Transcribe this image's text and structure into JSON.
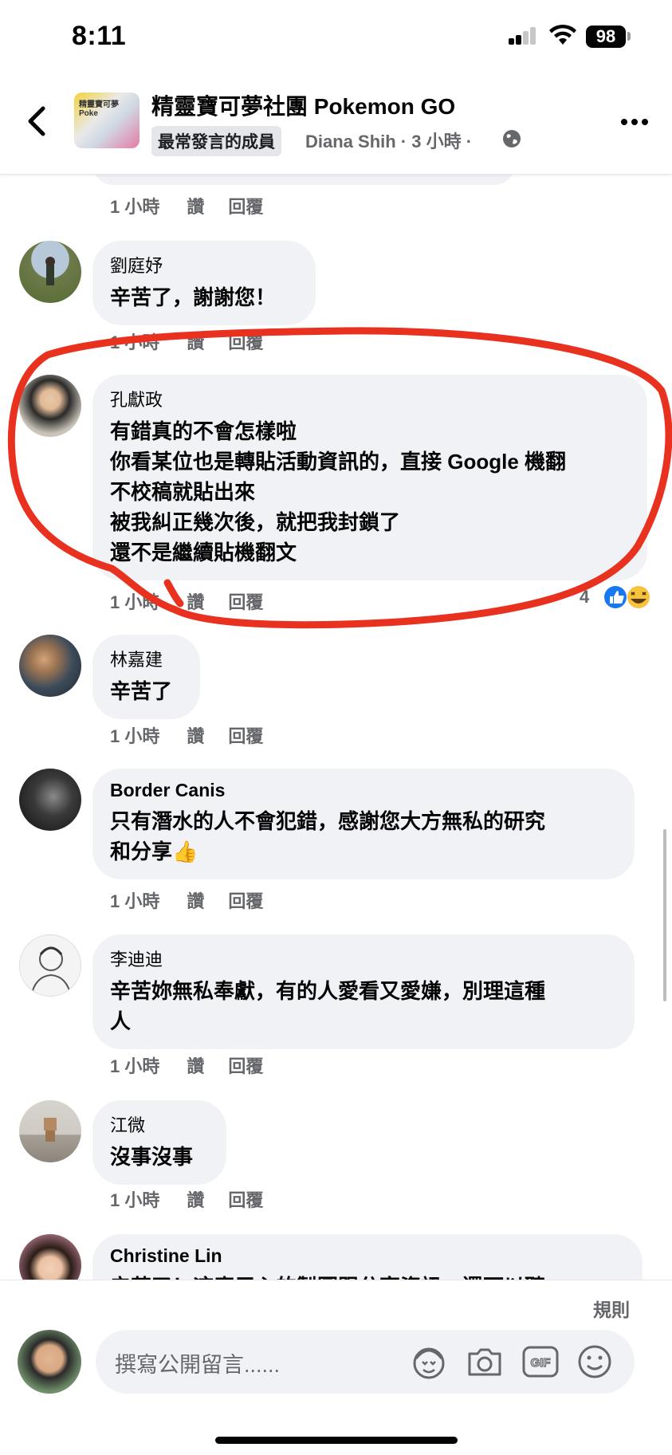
{
  "status_bar": {
    "time": "8:11",
    "battery": "98"
  },
  "header": {
    "title": "精靈寶可夢社團 Pokemon GO",
    "member_badge": "最常發言的成員",
    "post_meta": "Diana Shih · 3 小時 ·",
    "avatar_text": "精靈寶可夢 Poke"
  },
  "comments": [
    {
      "name": "",
      "text": "",
      "time": "1 小時",
      "like": "讚",
      "reply": "回覆"
    },
    {
      "name": "劉庭妤",
      "text": "辛苦了，謝謝您！",
      "time": "1 小時",
      "like": "讚",
      "reply": "回覆"
    },
    {
      "name": "孔獻政",
      "text": "有錯真的不會怎樣啦\n你看某位也是轉貼活動資訊的，直接 Google 機翻\n不校稿就貼出來\n被我糾正幾次後，就把我封鎖了\n還不是繼續貼機翻文",
      "time": "1 小時",
      "like": "讚",
      "reply": "回覆",
      "reaction_count": "4"
    },
    {
      "name": "林嘉建",
      "text": "辛苦了",
      "time": "1 小時",
      "like": "讚",
      "reply": "回覆"
    },
    {
      "name": "Border Canis",
      "text": "只有潛水的人不會犯錯，感謝您大方無私的研究\n和分享👍",
      "time": "1 小時",
      "like": "讚",
      "reply": "回覆"
    },
    {
      "name": "李迪迪",
      "text": "辛苦妳無私奉獻，有的人愛看又愛嫌，別理這種\n人",
      "time": "1 小時",
      "like": "讚",
      "reply": "回覆"
    },
    {
      "name": "江微",
      "text": "沒事沒事",
      "time": "1 小時",
      "like": "讚",
      "reply": "回覆"
    },
    {
      "name": "Christine Lin",
      "text": "辛苦了！這麼用心的製圖跟分享資訊，還可以聽"
    }
  ],
  "composer": {
    "rules": "規則",
    "placeholder": "撰寫公開留言......"
  },
  "colors": {
    "annotation_red": "#e8321f",
    "like_blue": "#1877f2",
    "bubble_bg": "#f0f2f5"
  }
}
